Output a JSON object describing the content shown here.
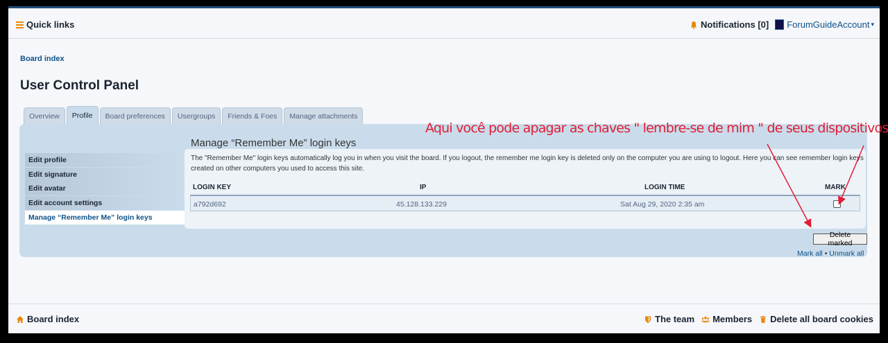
{
  "header": {
    "quick_links": "Quick links",
    "notifications": "Notifications [0]",
    "username": "ForumGuideAccount",
    "username_caret": "▾"
  },
  "breadcrumb": "Board index",
  "page_title": "User Control Panel",
  "tabs": [
    {
      "label": "Overview"
    },
    {
      "label": "Profile",
      "active": true
    },
    {
      "label": "Board preferences"
    },
    {
      "label": "Usergroups"
    },
    {
      "label": "Friends & Foes"
    },
    {
      "label": "Manage attachments"
    }
  ],
  "sidebar": {
    "items": [
      {
        "label": "Edit profile"
      },
      {
        "label": "Edit signature"
      },
      {
        "label": "Edit avatar"
      },
      {
        "label": "Edit account settings"
      },
      {
        "label": "Manage “Remember Me” login keys",
        "active": true
      }
    ]
  },
  "content": {
    "title": "Manage “Remember Me” login keys",
    "description": "The \"Remember Me\" login keys automatically log you in when you visit the board. If you logout, the remember me login key is deleted only on the computer you are using to logout. Here you can see remember login keys created on other computers you used to access this site.",
    "columns": {
      "key": "LOGIN KEY",
      "ip": "IP",
      "time": "LOGIN TIME",
      "mark": "MARK"
    },
    "rows": [
      {
        "key": "a792d692",
        "ip": "45.128.133.229",
        "time": "Sat Aug 29, 2020 2:35 am"
      }
    ],
    "delete_button": "Delete marked",
    "mark_all": "Mark all",
    "separator": "•",
    "unmark_all": "Unmark all"
  },
  "annotation": "Aqui você pode apagar as chaves \" lembre-se de mim \" de seus dispositivos",
  "footer": {
    "board_index": "Board index",
    "team": "The team",
    "members": "Members",
    "delete_cookies": "Delete all board cookies"
  },
  "colors": {
    "accent_orange": "#e8890c",
    "link_blue": "#105289",
    "panel_bg": "#cadceb",
    "annotation_red": "#e11d35"
  },
  "icons": [
    "menu-icon",
    "bell-icon",
    "home-icon",
    "shield-icon",
    "users-icon",
    "trash-icon"
  ]
}
